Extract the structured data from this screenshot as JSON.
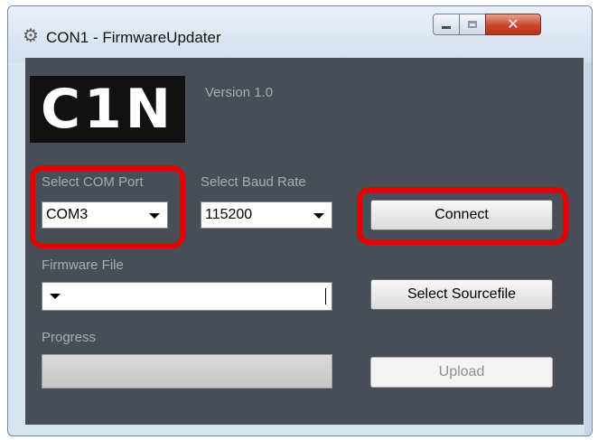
{
  "window": {
    "title": "CON1 - FirmwareUpdater",
    "icon": "gear-icon",
    "controls": {
      "minimize": "minimize-icon",
      "maximize": "maximize-icon",
      "close": "✕"
    }
  },
  "header": {
    "logo_text": "C1N",
    "version": "Version 1.0"
  },
  "com_port": {
    "label": "Select COM Port",
    "value": "COM3"
  },
  "baud_rate": {
    "label": "Select Baud Rate",
    "value": "115200"
  },
  "connect_button": "Connect",
  "firmware": {
    "label": "Firmware File",
    "value": ""
  },
  "select_sourcefile_button": "Select Sourcefile",
  "progress": {
    "label": "Progress",
    "value": 0
  },
  "upload_button": "Upload",
  "colors": {
    "client_background": "#474e55",
    "highlight": "#e60000",
    "title_bar": "#d9e4f1"
  }
}
